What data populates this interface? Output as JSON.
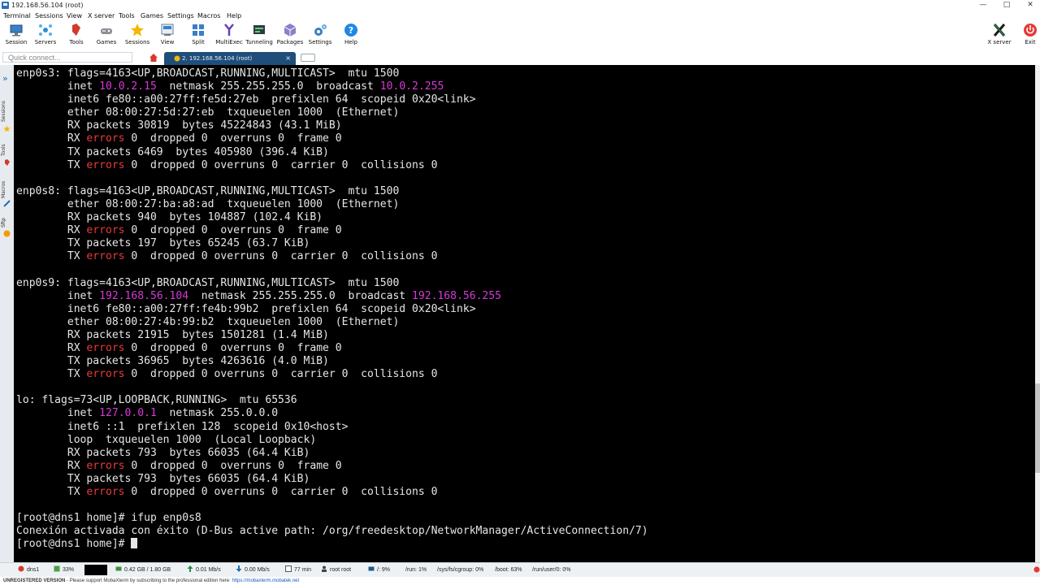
{
  "window": {
    "title": "192.168.56.104 (root)",
    "minimize": "—",
    "maximize": "□",
    "close": "✕"
  },
  "menu": [
    "Terminal",
    "Sessions",
    "View",
    "X server",
    "Tools",
    "Games",
    "Settings",
    "Macros",
    "Help"
  ],
  "toolbar": {
    "session": "Session",
    "servers": "Servers",
    "tools": "Tools",
    "games": "Games",
    "sessions": "Sessions",
    "view": "View",
    "split": "Split",
    "multiexec": "MultiExec",
    "tunneling": "Tunneling",
    "packages": "Packages",
    "settings": "Settings",
    "help": "Help",
    "xserver": "X server",
    "exit": "Exit"
  },
  "tabs": {
    "quick_connect_placeholder": "Quick connect...",
    "active_tab": "2. 192.168.56.104 (root)",
    "close": "×"
  },
  "sidebar": {
    "sessions": "Sessions",
    "tools": "Tools",
    "macros": "Macros",
    "sftp": "Sftp"
  },
  "terminal": {
    "lines": [
      [
        {
          "t": "enp0s3: flags=4163<UP,BROADCAST,RUNNING,MULTICAST>  mtu 1500"
        }
      ],
      [
        {
          "t": "        inet "
        },
        {
          "t": "10.0.2.15",
          "c": "mag"
        },
        {
          "t": "  netmask 255.255.255.0  broadcast "
        },
        {
          "t": "10.0.2.255",
          "c": "mag"
        }
      ],
      [
        {
          "t": "        inet6 fe80::a00:27ff:fe5d:27eb  prefixlen 64  scopeid 0x20<link>"
        }
      ],
      [
        {
          "t": "        ether 08:00:27:5d:27:eb  txqueuelen 1000  (Ethernet)"
        }
      ],
      [
        {
          "t": "        RX packets 30819  bytes 45224843 (43.1 MiB)"
        }
      ],
      [
        {
          "t": "        RX "
        },
        {
          "t": "errors",
          "c": "red"
        },
        {
          "t": " 0  dropped 0  overruns 0  frame 0"
        }
      ],
      [
        {
          "t": "        TX packets 6469  bytes 405980 (396.4 KiB)"
        }
      ],
      [
        {
          "t": "        TX "
        },
        {
          "t": "errors",
          "c": "red"
        },
        {
          "t": " 0  dropped 0 overruns 0  carrier 0  collisions 0"
        }
      ],
      [
        {
          "t": ""
        }
      ],
      [
        {
          "t": "enp0s8: flags=4163<UP,BROADCAST,RUNNING,MULTICAST>  mtu 1500"
        }
      ],
      [
        {
          "t": "        ether 08:00:27:ba:a8:ad  txqueuelen 1000  (Ethernet)"
        }
      ],
      [
        {
          "t": "        RX packets 940  bytes 104887 (102.4 KiB)"
        }
      ],
      [
        {
          "t": "        RX "
        },
        {
          "t": "errors",
          "c": "red"
        },
        {
          "t": " 0  dropped 0  overruns 0  frame 0"
        }
      ],
      [
        {
          "t": "        TX packets 197  bytes 65245 (63.7 KiB)"
        }
      ],
      [
        {
          "t": "        TX "
        },
        {
          "t": "errors",
          "c": "red"
        },
        {
          "t": " 0  dropped 0 overruns 0  carrier 0  collisions 0"
        }
      ],
      [
        {
          "t": ""
        }
      ],
      [
        {
          "t": "enp0s9: flags=4163<UP,BROADCAST,RUNNING,MULTICAST>  mtu 1500"
        }
      ],
      [
        {
          "t": "        inet "
        },
        {
          "t": "192.168.56.104",
          "c": "mag"
        },
        {
          "t": "  netmask 255.255.255.0  broadcast "
        },
        {
          "t": "192.168.56.255",
          "c": "mag"
        }
      ],
      [
        {
          "t": "        inet6 fe80::a00:27ff:fe4b:99b2  prefixlen 64  scopeid 0x20<link>"
        }
      ],
      [
        {
          "t": "        ether 08:00:27:4b:99:b2  txqueuelen 1000  (Ethernet)"
        }
      ],
      [
        {
          "t": "        RX packets 21915  bytes 1501281 (1.4 MiB)"
        }
      ],
      [
        {
          "t": "        RX "
        },
        {
          "t": "errors",
          "c": "red"
        },
        {
          "t": " 0  dropped 0  overruns 0  frame 0"
        }
      ],
      [
        {
          "t": "        TX packets 36965  bytes 4263616 (4.0 MiB)"
        }
      ],
      [
        {
          "t": "        TX "
        },
        {
          "t": "errors",
          "c": "red"
        },
        {
          "t": " 0  dropped 0 overruns 0  carrier 0  collisions 0"
        }
      ],
      [
        {
          "t": ""
        }
      ],
      [
        {
          "t": "lo: flags=73<UP,LOOPBACK,RUNNING>  mtu 65536"
        }
      ],
      [
        {
          "t": "        inet "
        },
        {
          "t": "127.0.0.1",
          "c": "mag"
        },
        {
          "t": "  netmask 255.0.0.0"
        }
      ],
      [
        {
          "t": "        inet6 ::1  prefixlen 128  scopeid 0x10<host>"
        }
      ],
      [
        {
          "t": "        loop  txqueuelen 1000  (Local Loopback)"
        }
      ],
      [
        {
          "t": "        RX packets 793  bytes 66035 (64.4 KiB)"
        }
      ],
      [
        {
          "t": "        RX "
        },
        {
          "t": "errors",
          "c": "red"
        },
        {
          "t": " 0  dropped 0  overruns 0  frame 0"
        }
      ],
      [
        {
          "t": "        TX packets 793  bytes 66035 (64.4 KiB)"
        }
      ],
      [
        {
          "t": "        TX "
        },
        {
          "t": "errors",
          "c": "red"
        },
        {
          "t": " 0  dropped 0 overruns 0  carrier 0  collisions 0"
        }
      ],
      [
        {
          "t": ""
        }
      ],
      [
        {
          "t": "[root@dns1 home]# ifup enp0s8"
        }
      ],
      [
        {
          "t": "Conexión activada con éxito (D-Bus active path: /org/freedesktop/NetworkManager/ActiveConnection/7)"
        }
      ],
      [
        {
          "t": "[root@dns1 home]# "
        }
      ]
    ]
  },
  "status": {
    "host": "dns1",
    "cpu": "33%",
    "memory": "0.42 GB / 1.80 GB",
    "upload": "0.01 Mb/s",
    "download": "0.00 Mb/s",
    "uptime": "77 min",
    "user": "root  root",
    "disk_root": "/: 9%",
    "disk_run": "/run: 1%",
    "disk_cgroup": "/sys/fs/cgroup: 0%",
    "disk_boot": "/boot: 63%",
    "disk_user": "/run/user/0: 0%"
  },
  "unregistered": {
    "label": "UNREGISTERED VERSION",
    "message": "  -  Please support MobaXterm by subscribing to the professional edition here: ",
    "link": "https://mobaxterm.mobatek.net"
  },
  "colors": {
    "terminal_bg": "#000000",
    "terminal_fg": "#e6e6e6",
    "ip_highlight": "#d53ad5",
    "error_highlight": "#e53b3b",
    "tab_active": "#1f4e7a"
  }
}
